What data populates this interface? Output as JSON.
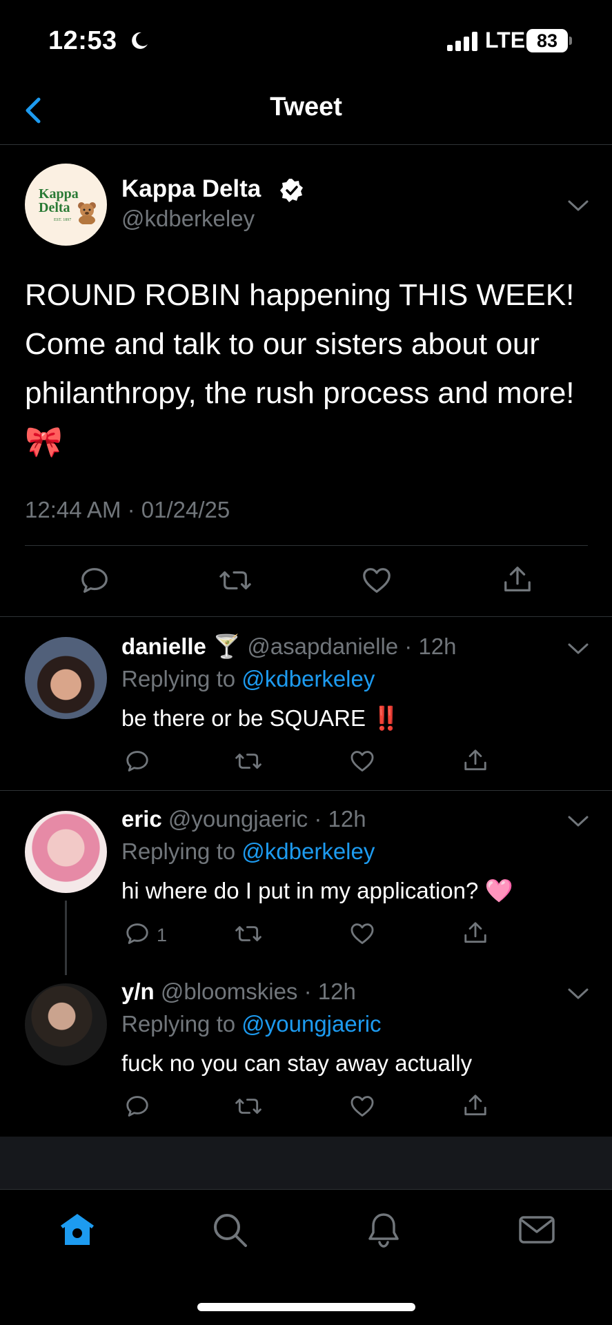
{
  "status_bar": {
    "time": "12:53",
    "network": "LTE",
    "battery": "83"
  },
  "nav": {
    "title": "Tweet"
  },
  "tweet": {
    "name": "Kappa Delta",
    "handle": "@kdberkeley",
    "avatar_text": "Kappa Delta",
    "avatar_est": "EST. 1897",
    "text": "ROUND ROBIN happening THIS WEEK! Come and talk to our sisters about our philanthropy, the rush process and more! 🎀",
    "timestamp": "12:44 AM · 01/24/25"
  },
  "replies": [
    {
      "name": "danielle 🍸",
      "handle": "@asapdanielle · 12h",
      "replying_prefix": "Replying to ",
      "replying_to": "@kdberkeley",
      "text": "be there or be SQUARE ‼️",
      "reply_count": ""
    },
    {
      "name": "eric",
      "handle": "@youngjaeric · 12h",
      "replying_prefix": "Replying to ",
      "replying_to": "@kdberkeley",
      "text": "hi where do I put in my application? 🩷",
      "reply_count": "1"
    },
    {
      "name": "y/n",
      "handle": "@bloomskies · 12h",
      "replying_prefix": "Replying to ",
      "replying_to": "@youngjaeric",
      "text": "fuck no you can stay away actually",
      "reply_count": ""
    }
  ],
  "colors": {
    "accent": "#1d9bf0",
    "muted": "#71767b",
    "divider": "#2f3336",
    "background": "#000000"
  },
  "icons": [
    "chevron-left-icon",
    "verified-icon",
    "chevron-down-icon",
    "reply-icon",
    "retweet-icon",
    "like-icon",
    "share-icon",
    "home-icon",
    "search-icon",
    "notifications-icon",
    "messages-icon"
  ]
}
